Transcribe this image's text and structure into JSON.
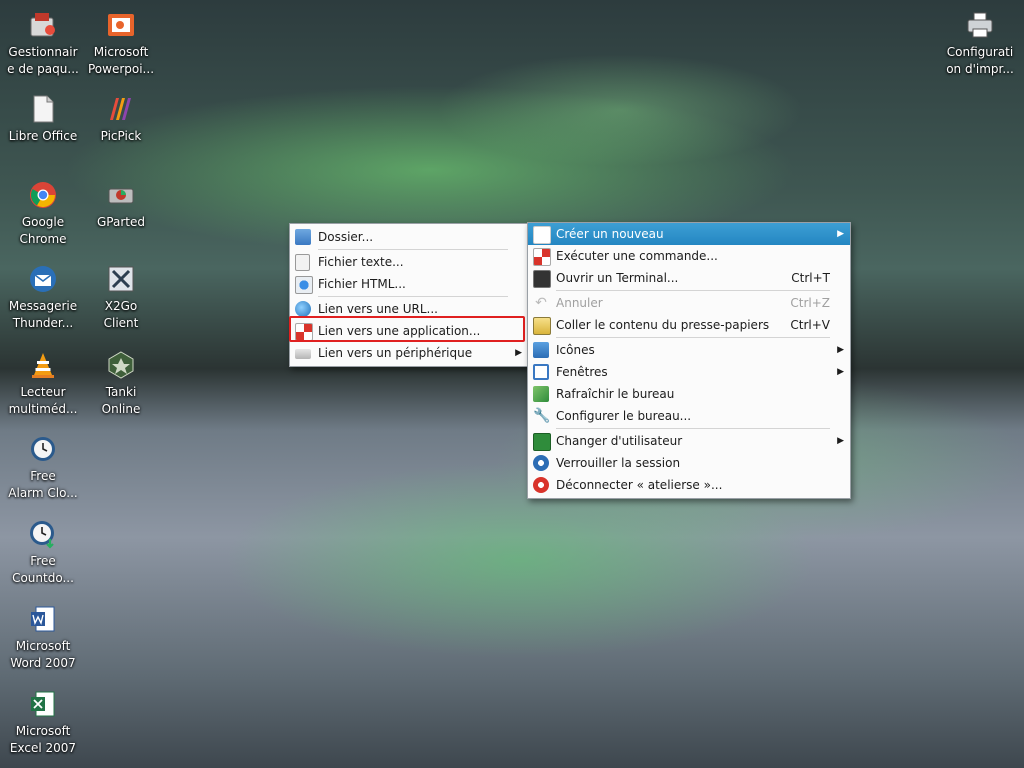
{
  "desktop": {
    "icons": [
      {
        "label": "Gestionnair\ne de paqu...",
        "icon": "package-manager-icon"
      },
      {
        "label": "Microsoft\nPowerpoi...",
        "icon": "powerpoint-icon"
      },
      {
        "label": "Libre Office",
        "icon": "libreoffice-icon"
      },
      {
        "label": "PicPick",
        "icon": "picpick-icon"
      },
      {
        "label": "Google\nChrome",
        "icon": "chrome-icon"
      },
      {
        "label": "GParted",
        "icon": "gparted-icon"
      },
      {
        "label": "Messagerie\nThunder...",
        "icon": "thunderbird-icon"
      },
      {
        "label": "X2Go\nClient",
        "icon": "x2go-icon"
      },
      {
        "label": "Lecteur\nmultiméd...",
        "icon": "vlc-icon"
      },
      {
        "label": "Tanki\nOnline",
        "icon": "tanki-icon"
      },
      {
        "label": "Free\nAlarm Clo...",
        "icon": "alarm-clock-icon"
      },
      {
        "label": "Free\nCountdo...",
        "icon": "countdown-icon"
      },
      {
        "label": "Microsoft\nWord 2007",
        "icon": "word-icon"
      },
      {
        "label": "Microsoft\nExcel 2007",
        "icon": "excel-icon"
      },
      {
        "label": "Configurati\non d'impr...",
        "icon": "printer-icon"
      }
    ]
  },
  "main_menu": {
    "items": [
      {
        "label": "Créer un nouveau",
        "shortcut": "",
        "icon": "create-new-icon"
      },
      {
        "label": "Exécuter une commande...",
        "shortcut": "",
        "icon": "run-command-icon"
      },
      {
        "label": "Ouvrir un Terminal...",
        "shortcut": "Ctrl+T",
        "icon": "terminal-icon"
      },
      {
        "label": "Annuler",
        "shortcut": "Ctrl+Z",
        "icon": "undo-icon"
      },
      {
        "label": "Coller le contenu du presse-papiers",
        "shortcut": "Ctrl+V",
        "icon": "paste-icon"
      },
      {
        "label": "Icônes",
        "shortcut": "",
        "icon": "icons-icon"
      },
      {
        "label": "Fenêtres",
        "shortcut": "",
        "icon": "windows-icon"
      },
      {
        "label": "Rafraîchir le bureau",
        "shortcut": "",
        "icon": "refresh-icon"
      },
      {
        "label": "Configurer le bureau...",
        "shortcut": "",
        "icon": "configure-icon"
      },
      {
        "label": "Changer d'utilisateur",
        "shortcut": "",
        "icon": "switch-user-icon"
      },
      {
        "label": "Verrouiller la session",
        "shortcut": "",
        "icon": "lock-icon"
      },
      {
        "label": "Déconnecter « atelierse »...",
        "shortcut": "",
        "icon": "logout-icon"
      }
    ]
  },
  "submenu": {
    "items": [
      {
        "label": "Dossier...",
        "icon": "folder-icon"
      },
      {
        "label": "Fichier texte...",
        "icon": "text-file-icon"
      },
      {
        "label": "Fichier HTML...",
        "icon": "html-file-icon"
      },
      {
        "label": "Lien vers une URL...",
        "icon": "url-link-icon"
      },
      {
        "label": "Lien vers une application...",
        "icon": "app-link-icon"
      },
      {
        "label": "Lien vers un périphérique",
        "icon": "device-link-icon"
      }
    ]
  },
  "colors": {
    "highlight": "#2e90c9",
    "annotation": "#e02020"
  }
}
